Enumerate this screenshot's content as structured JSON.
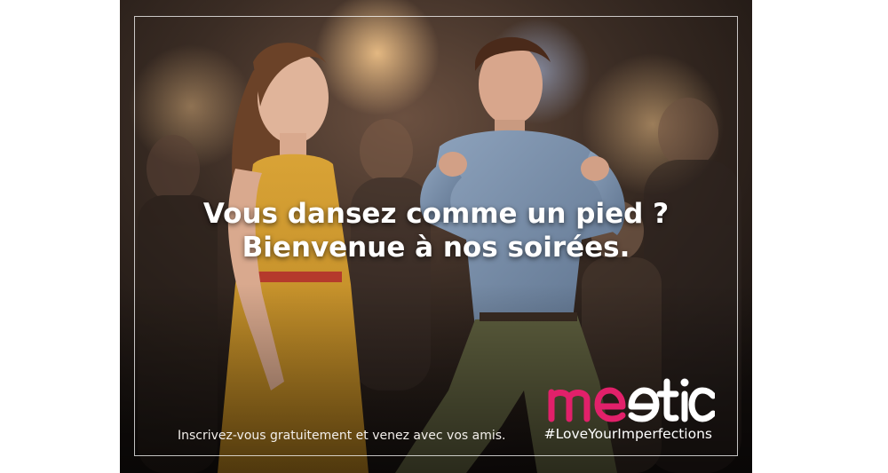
{
  "ad": {
    "headline_line1": "Vous dansez comme un pied ?",
    "headline_line2": "Bienvenue à nos soirées.",
    "signup_text": "Inscrivez-vous gratuitement et venez avec vos amis.",
    "brand_name": "meetic",
    "hashtag": "#LoveYourImperfections"
  },
  "colors": {
    "brand_pink": "#e2206a",
    "text_white": "#ffffff"
  }
}
